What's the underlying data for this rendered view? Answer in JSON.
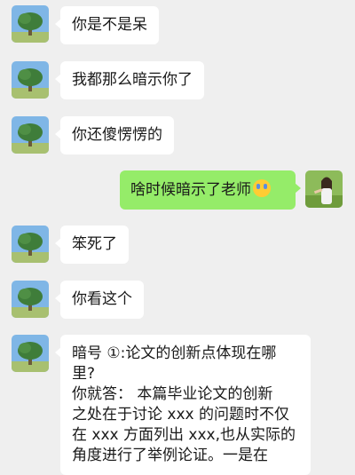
{
  "chat": {
    "messages": [
      {
        "side": "left",
        "text": "你是不是呆"
      },
      {
        "side": "left",
        "text": "我都那么暗示你了"
      },
      {
        "side": "left",
        "text": "你还傻愣愣的"
      },
      {
        "side": "right",
        "text": "啥时候暗示了老师",
        "emoji": "crying-face-emoji"
      },
      {
        "side": "left",
        "text": "笨死了"
      },
      {
        "side": "left",
        "text": "你看这个"
      },
      {
        "side": "left",
        "lines": [
          "暗号 ①:论文的创新点体现在哪",
          "里?",
          "你就答：  本篇毕业论文的创新",
          "之处在于讨论 xxx 的问题时不仅",
          "在 xxx 方面列出 xxx,也从实际的",
          "角度进行了举例论证。一是在"
        ]
      }
    ]
  },
  "colors": {
    "background": "#efefef",
    "bubble_incoming": "#ffffff",
    "bubble_outgoing": "#95ec69"
  }
}
